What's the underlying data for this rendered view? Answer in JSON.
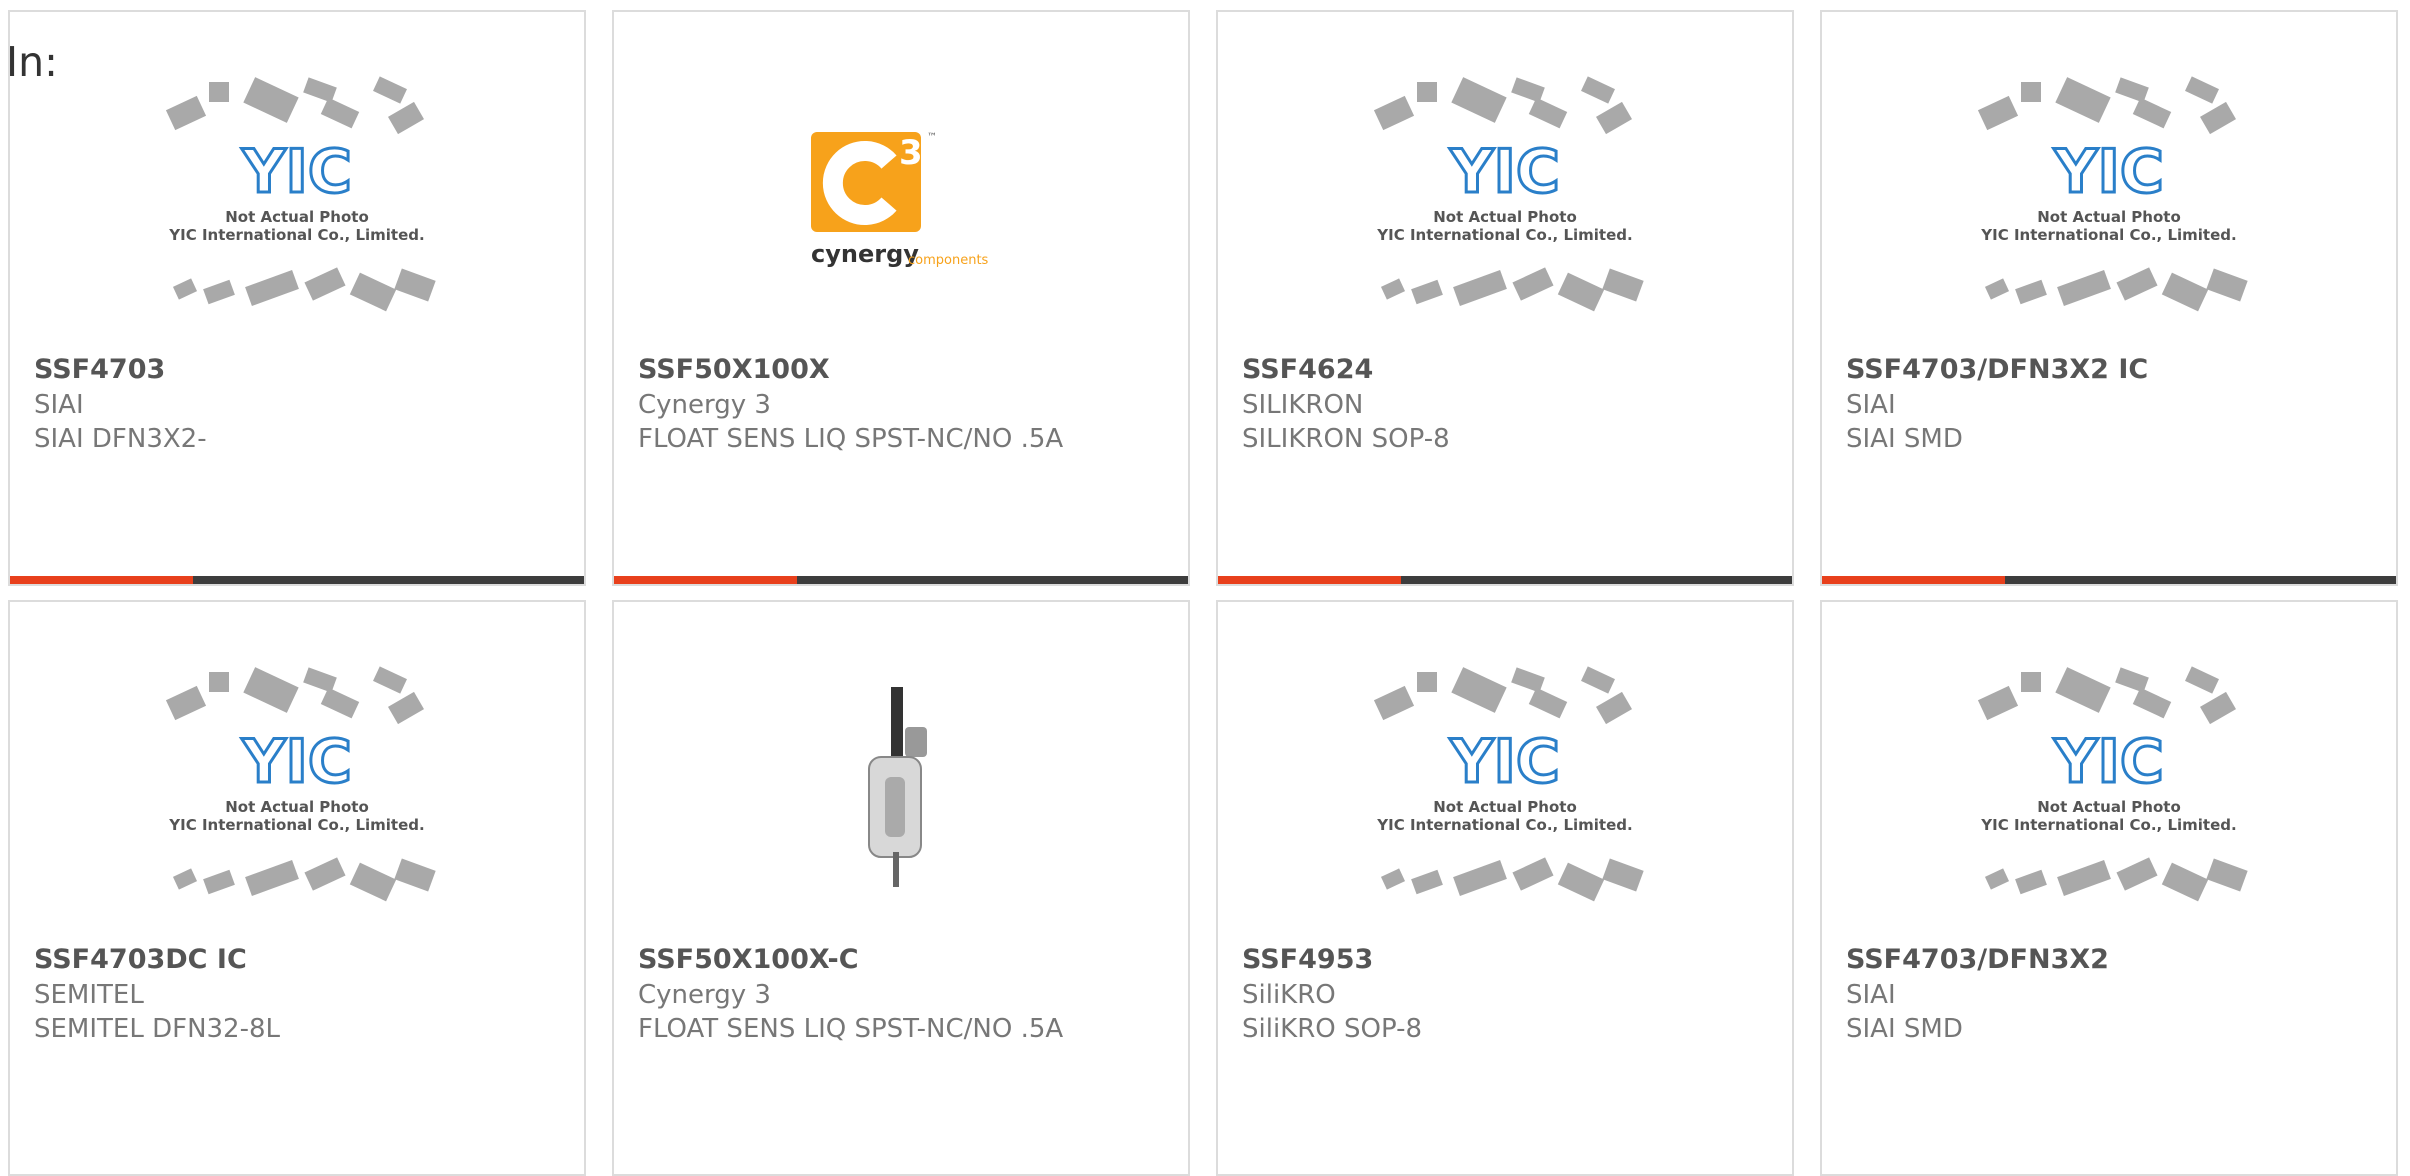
{
  "page": {
    "in_label": "In:"
  },
  "placeholder": {
    "line1": "Not Actual Photo",
    "line2": "YIC International Co., Limited.",
    "logo_text": "YIC"
  },
  "cynergy_logo": {
    "superscript": "3",
    "word": "cynergy",
    "sub": "components",
    "tm": "™"
  },
  "colors": {
    "accent": "#e8401c",
    "bar": "#3d3d3d",
    "yic_blue": "#2a7fc9",
    "cynergy_orange": "#f7a21b"
  },
  "products": [
    {
      "part": "SSF4703",
      "manufacturer": "SIAI",
      "description": "SIAI DFN3X2-",
      "image": "yic-placeholder"
    },
    {
      "part": "SSF50X100X",
      "manufacturer": "Cynergy 3",
      "description": "FLOAT SENS LIQ SPST-NC/NO .5A",
      "image": "cynergy3-logo"
    },
    {
      "part": "SSF4624",
      "manufacturer": "SILIKRON",
      "description": "SILIKRON SOP-8",
      "image": "yic-placeholder"
    },
    {
      "part": "SSF4703/DFN3X2 IC",
      "manufacturer": "SIAI",
      "description": "SIAI SMD",
      "image": "yic-placeholder"
    },
    {
      "part": "SSF4703DC IC",
      "manufacturer": "SEMITEL",
      "description": "SEMITEL DFN32-8L",
      "image": "yic-placeholder"
    },
    {
      "part": "SSF50X100X-C",
      "manufacturer": "Cynergy 3",
      "description": "FLOAT SENS LIQ SPST-NC/NO .5A",
      "image": "float-sensor-photo"
    },
    {
      "part": "SSF4953",
      "manufacturer": "SiliKRO",
      "description": "SiliKRO SOP-8",
      "image": "yic-placeholder"
    },
    {
      "part": "SSF4703/DFN3X2",
      "manufacturer": "SIAI",
      "description": "SIAI SMD",
      "image": "yic-placeholder"
    }
  ]
}
